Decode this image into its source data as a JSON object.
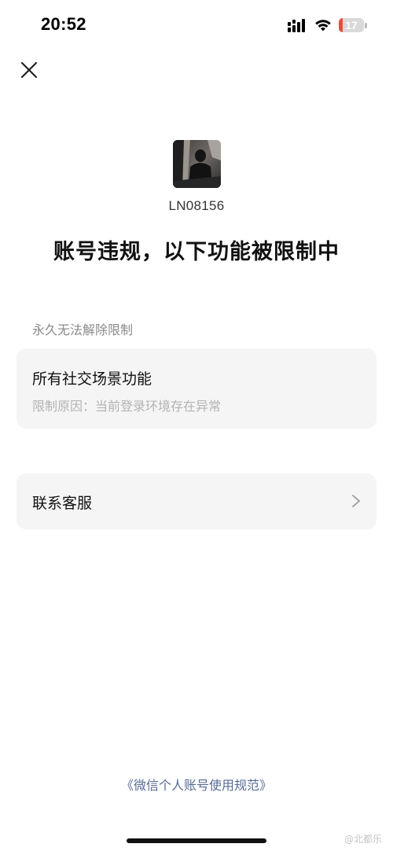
{
  "status_bar": {
    "time": "20:52",
    "battery_level": "17",
    "battery_fraction": 0.17,
    "icons": [
      "signal-icon",
      "wifi-icon",
      "battery-icon"
    ]
  },
  "header": {
    "close_icon": "close-icon"
  },
  "profile": {
    "account_id": "LN08156"
  },
  "title": "账号违规，以下功能被限制中",
  "restriction": {
    "section_label": "永久无法解除限制",
    "feature": "所有社交场景功能",
    "reason": "限制原因：当前登录环境存在异常"
  },
  "support": {
    "label": "联系客服",
    "icon": "chevron-right-icon"
  },
  "footer": {
    "policy_link": "《微信个人账号使用规范》",
    "watermark": "@北都乐"
  },
  "colors": {
    "background": "#ffffff",
    "card": "#f5f5f5",
    "link": "#576b95",
    "secondary_text": "#8a8a8a",
    "battery_low": "#eb4b3f"
  }
}
